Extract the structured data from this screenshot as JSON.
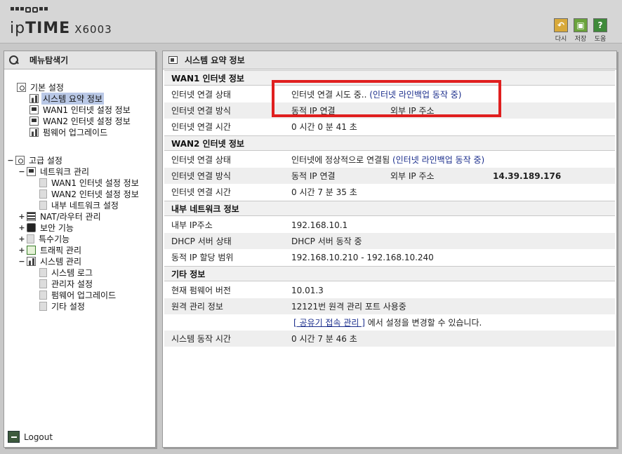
{
  "header": {
    "brand_ip": "ip",
    "brand_time": "TIME",
    "model": "X6003",
    "toolbar": [
      {
        "label": "다시",
        "icon": "undo-icon",
        "color": "#d8a93a",
        "glyph": "↶"
      },
      {
        "label": "저장",
        "icon": "save-icon",
        "color": "#6aa33c",
        "glyph": "▣"
      },
      {
        "label": "도움",
        "icon": "help-icon",
        "color": "#3f8a3a",
        "glyph": "?"
      }
    ]
  },
  "sidebar": {
    "title": "메뉴탐색기",
    "logout": "Logout",
    "basic": {
      "label": "기본 설정",
      "items": [
        "시스템 요약 정보",
        "WAN1 인터넷 설정 정보",
        "WAN2 인터넷 설정 정보",
        "펌웨어 업그레이드"
      ]
    },
    "advanced": {
      "label": "고급 설정",
      "network": {
        "label": "네트워크 관리",
        "items": [
          "WAN1 인터넷 설정 정보",
          "WAN2 인터넷 설정 정보",
          "내부 네트워크 설정"
        ]
      },
      "nat": "NAT/라우터 관리",
      "security": "보안 기능",
      "special": "특수기능",
      "traffic": "트래픽 관리",
      "system": {
        "label": "시스템 관리",
        "items": [
          "시스템 로그",
          "관리자 설정",
          "펌웨어 업그레이드",
          "기타 설정"
        ]
      }
    }
  },
  "main": {
    "title": "시스템 요약 정보",
    "wan1": {
      "title": "WAN1 인터넷 정보",
      "status_label": "인터넷 연결 상태",
      "status_value": "인터넷 연결 시도 중..",
      "status_link": "(인터넷 라인백업 동작 중)",
      "method_label": "인터넷 연결 방식",
      "method_value": "동적 IP 연결",
      "ext_ip_label": "외부 IP 주소",
      "ext_ip_value": "",
      "time_label": "인터넷 연결 시간",
      "time_value": "0 시간 0 분 41 초"
    },
    "wan2": {
      "title": "WAN2 인터넷 정보",
      "status_label": "인터넷 연결 상태",
      "status_value": "인터넷에 정상적으로 연결됨",
      "status_link": "(인터넷 라인백업 동작 중)",
      "method_label": "인터넷 연결 방식",
      "method_value": "동적 IP 연결",
      "ext_ip_label": "외부 IP 주소",
      "ext_ip_value": "14.39.189.176",
      "time_label": "인터넷 연결 시간",
      "time_value": "0 시간 7 분 35 초"
    },
    "lan": {
      "title": "내부 네트워크 정보",
      "ip_label": "내부 IP주소",
      "ip_value": "192.168.10.1",
      "dhcp_label": "DHCP 서버 상태",
      "dhcp_value": "DHCP 서버 동작 중",
      "range_label": "동적 IP 할당 범위",
      "range_value": "192.168.10.210 -  192.168.10.240"
    },
    "etc": {
      "title": "기타 정보",
      "fw_label": "현재 펌웨어 버전",
      "fw_value": "10.01.3",
      "remote_label": "원격 관리 정보",
      "remote_value": "12121번 원격 관리 포트 사용중",
      "remote_link": "[ 공유기 접속 관리 ]",
      "remote_note": " 에서 설정을 변경할 수 있습니다.",
      "uptime_label": "시스템 동작 시간",
      "uptime_value": "0 시간 7 분 46 초"
    }
  },
  "colors": {
    "highlight": "#e01f1f",
    "link": "#1b2e8c",
    "selected": "#b9c8e6"
  }
}
